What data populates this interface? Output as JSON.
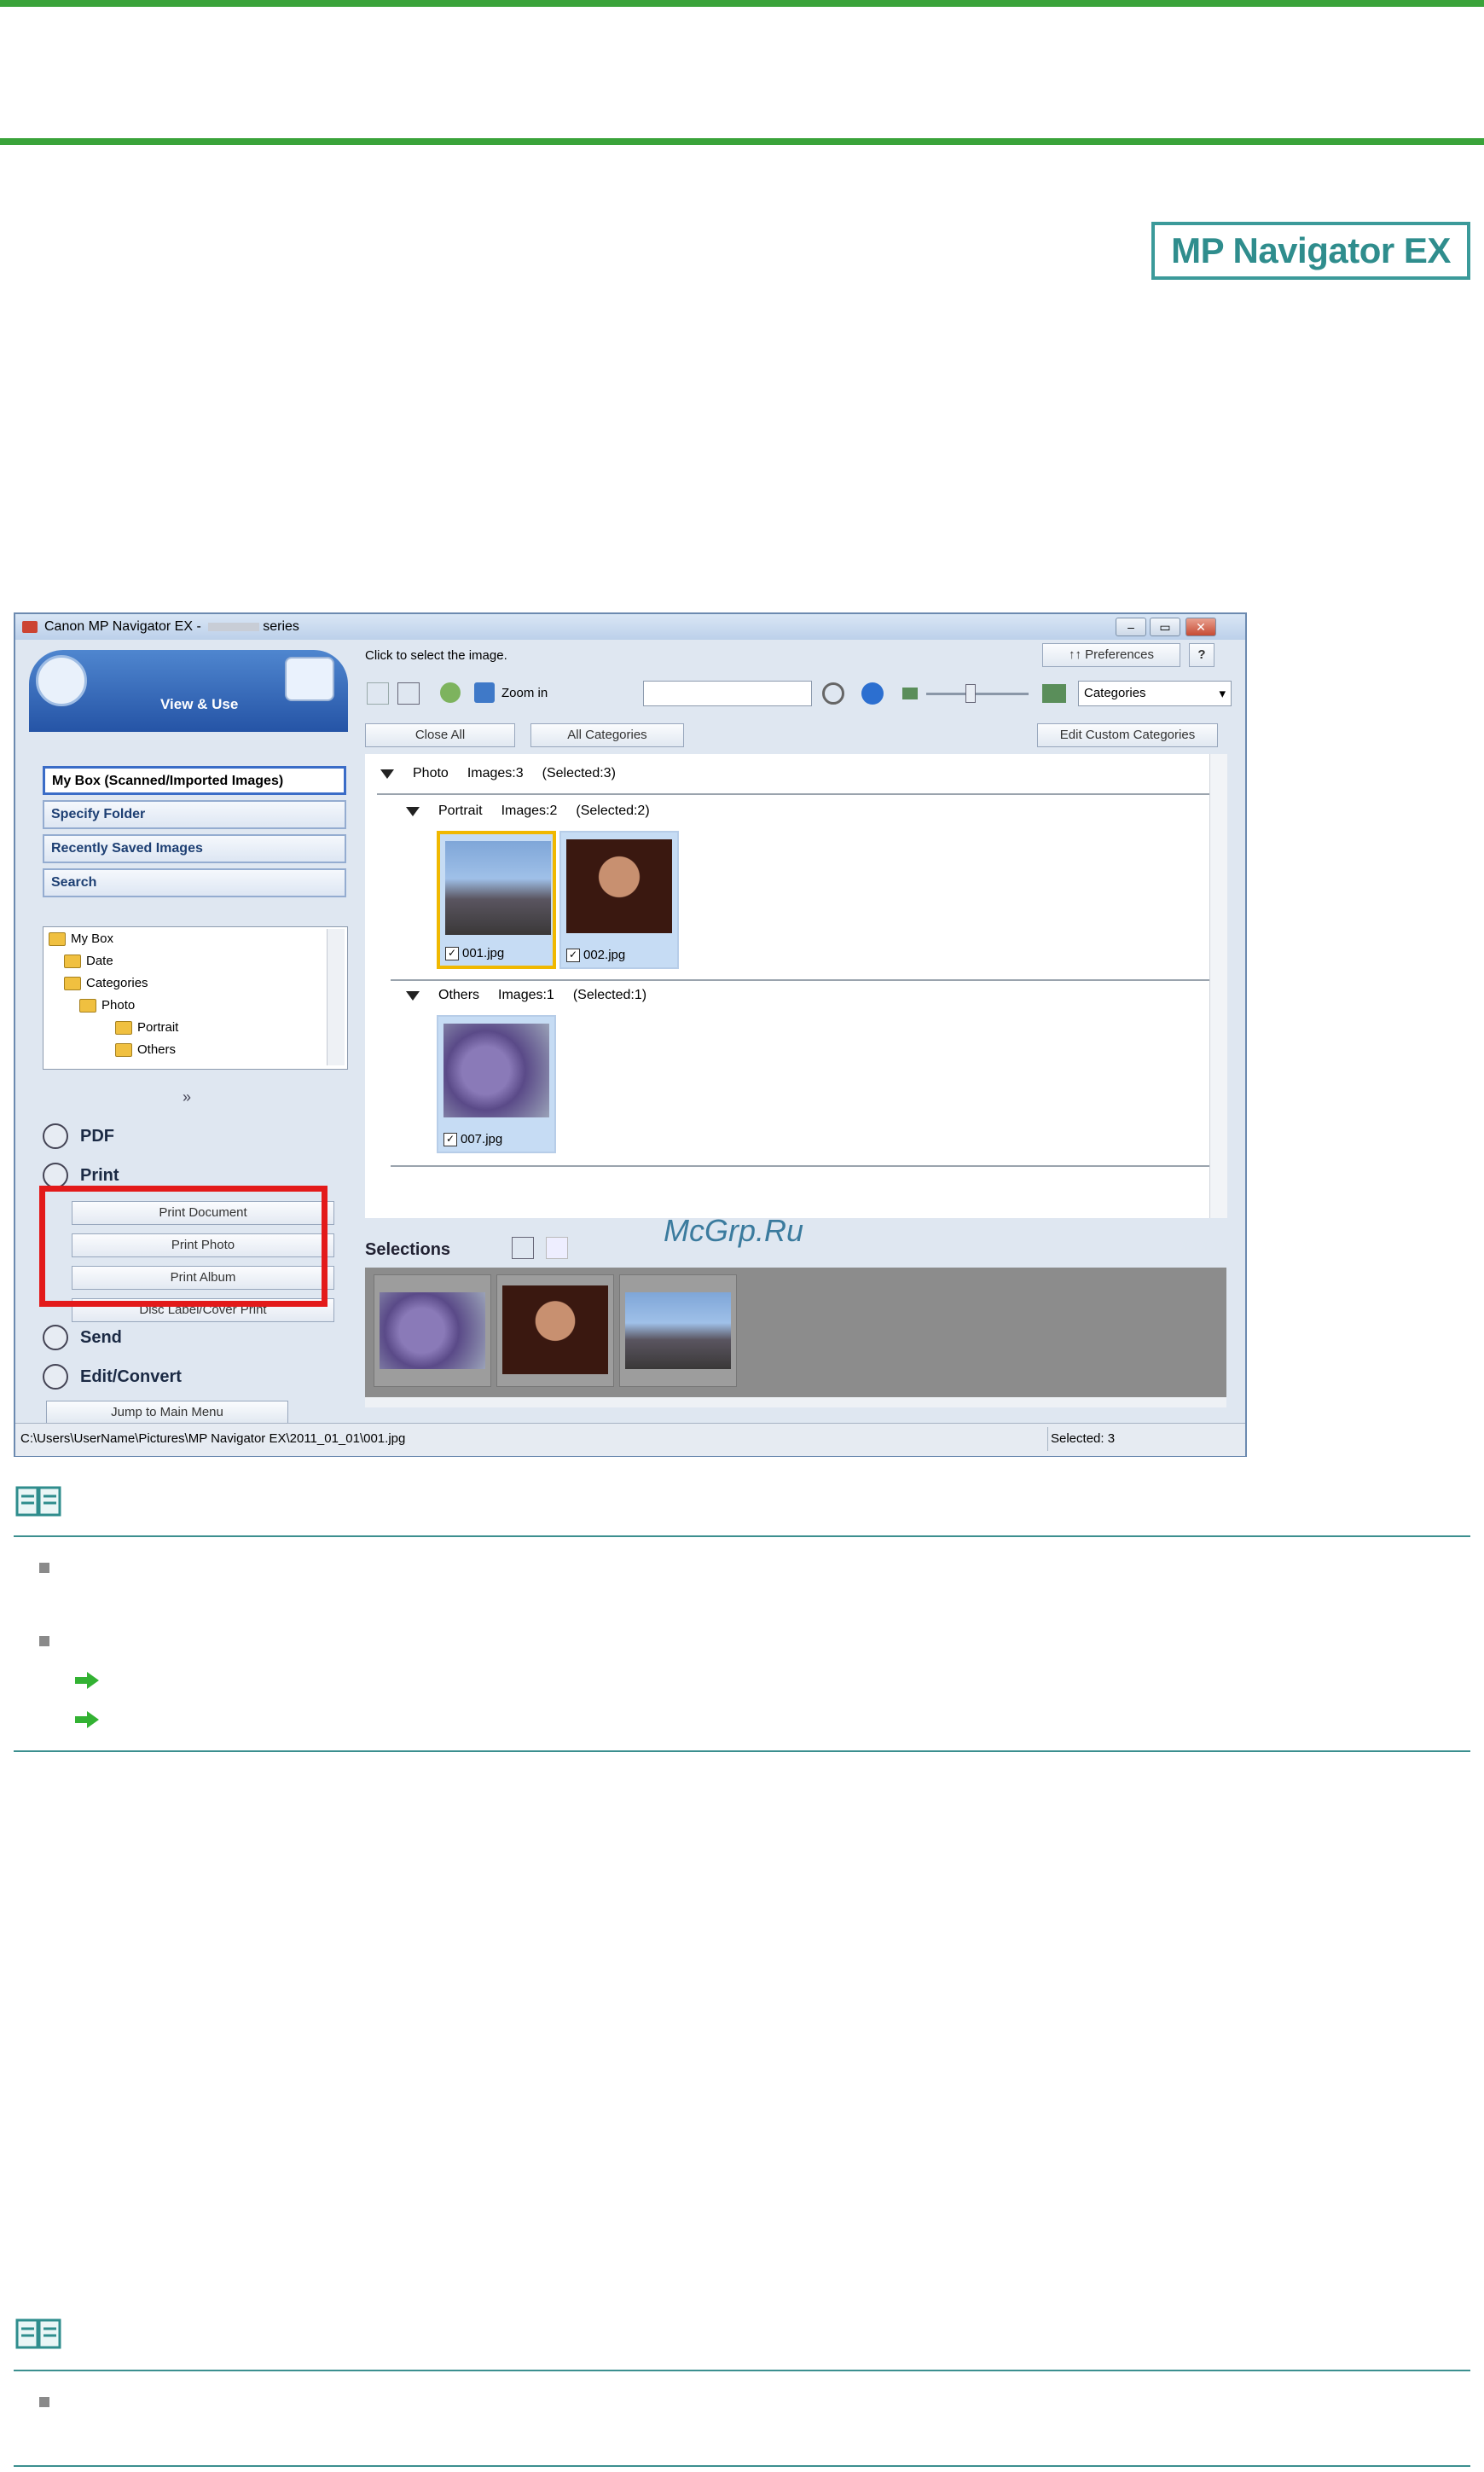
{
  "header": {
    "logo_text": "MP Navigator EX"
  },
  "window": {
    "title": "Canon MP Navigator EX - ",
    "title_suffix": "series",
    "left": {
      "mode_label": "View & Use",
      "nav": [
        "My Box (Scanned/Imported Images)",
        "Specify Folder",
        "Recently Saved Images",
        "Search"
      ],
      "tree": [
        "My Box",
        "Date",
        "Categories",
        "Photo",
        "Portrait",
        "Others"
      ],
      "sections": [
        "PDF",
        "Print",
        "Send",
        "Edit/Convert"
      ],
      "print_buttons": [
        "Print Document",
        "Print Photo",
        "Print Album",
        "Disc Label/Cover Print"
      ],
      "jump_button": "Jump to Main Menu"
    },
    "right": {
      "instruction": "Click to select the image.",
      "preferences": "Preferences",
      "help": "?",
      "zoom_in": "Zoom in",
      "sort_select": "Categories",
      "close_all": "Close All",
      "all_categories": "All Categories",
      "edit_custom": "Edit Custom Categories",
      "group_photo": {
        "name": "Photo",
        "images": "Images:3",
        "selected": "(Selected:3)"
      },
      "group_portrait": {
        "name": "Portrait",
        "images": "Images:2",
        "selected": "(Selected:2)"
      },
      "group_others": {
        "name": "Others",
        "images": "Images:1",
        "selected": "(Selected:1)"
      },
      "thumbs": [
        "001.jpg",
        "002.jpg",
        "007.jpg"
      ],
      "selections_label": "Selections"
    },
    "status": {
      "path": "C:\\Users\\UserName\\Pictures\\MP Navigator EX\\2011_01_01\\001.jpg",
      "selected": "Selected: 3"
    }
  },
  "watermark": "McGrp.Ru",
  "colors": {
    "accent_green": "#3aa33a",
    "teal": "#3b8f8f",
    "highlight_red": "#e31a1a"
  }
}
